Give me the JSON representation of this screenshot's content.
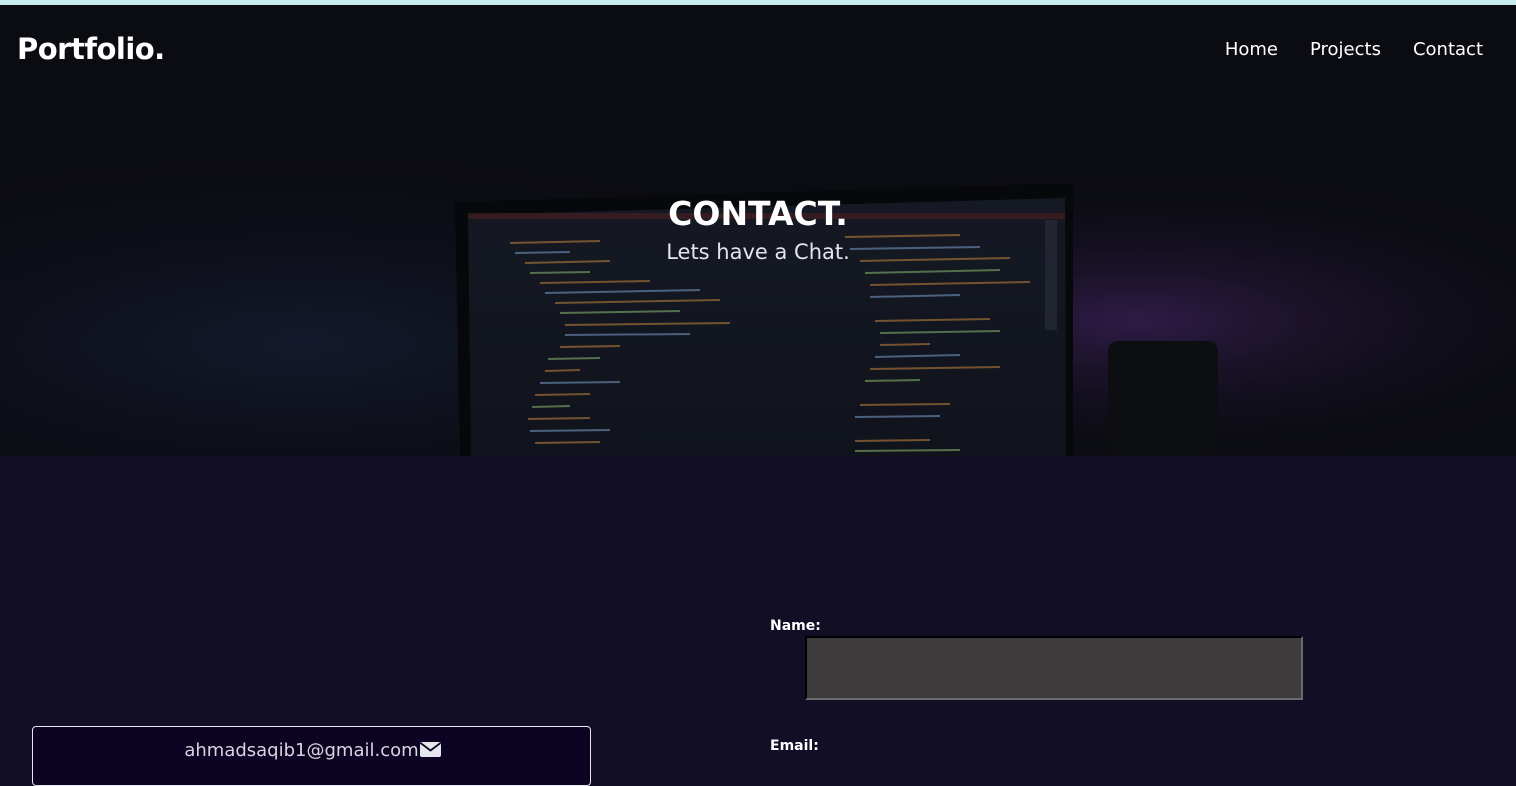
{
  "header": {
    "brand": "Portfolio.",
    "nav": [
      {
        "label": "Home"
      },
      {
        "label": "Projects"
      },
      {
        "label": "Contact"
      }
    ]
  },
  "hero": {
    "title": "CONTACT.",
    "subtitle": "Lets have a Chat."
  },
  "contact_info": {
    "email": "ahmadsaqib1@gmail.com",
    "icon": "envelope-icon"
  },
  "form": {
    "name_label": "Name:",
    "name_value": "",
    "email_label": "Email:"
  },
  "colors": {
    "page_background": "#110e26",
    "top_strip": "#c7ebee",
    "input_background": "#3d3b3c",
    "card_background": "#0d0424"
  }
}
